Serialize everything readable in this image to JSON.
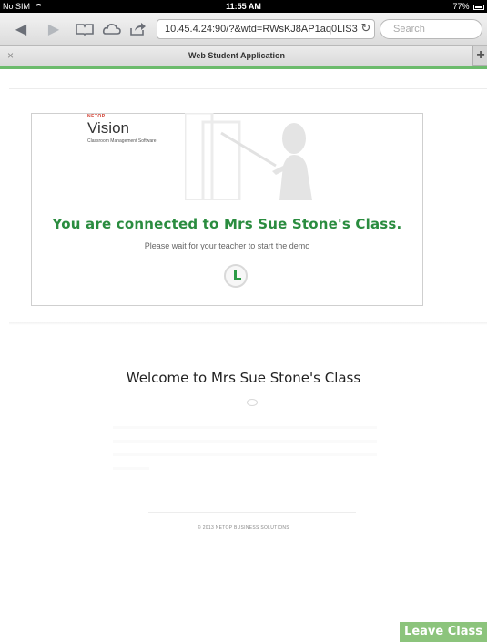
{
  "status_bar": {
    "carrier": "No SIM",
    "time": "11:55 AM",
    "battery": "77%"
  },
  "browser": {
    "url": "10.45.4.24:90/?&wtd=RWsKJ8AP1aq0LIS3",
    "search_placeholder": "Search",
    "icons": [
      "back-icon",
      "forward-icon",
      "bookmarks-icon",
      "cloud-icon",
      "share-icon",
      "reload-icon"
    ],
    "tab_title": "Web Student Application",
    "tab_close": "×",
    "tab_add": "+"
  },
  "brand": {
    "small": "NETOP",
    "name": "Vision",
    "tagline": "Classroom Management Software"
  },
  "status_panel": {
    "connected_text": "You are connected to Mrs Sue Stone's Class.",
    "wait_text": "Please wait for your teacher to start the demo"
  },
  "welcome": {
    "title": "Welcome to Mrs Sue Stone's Class",
    "copyright": "© 2013 NETOP BUSINESS SOLUTIONS"
  },
  "actions": {
    "leave_label": "Leave Class"
  },
  "colors": {
    "accent_green": "#2a8c3f",
    "leave_button": "#8cc47c",
    "tab_rule": "#6cbb6c"
  }
}
